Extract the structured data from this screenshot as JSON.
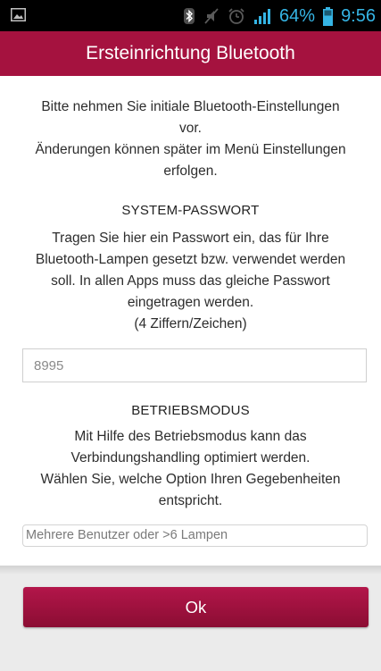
{
  "status_bar": {
    "battery_percent": "64%",
    "time": "9:56",
    "icons": [
      "image-icon",
      "bluetooth-icon",
      "mute-icon",
      "alarm-icon",
      "signal-icon",
      "battery-icon"
    ]
  },
  "header": {
    "title": "Ersteinrichtung Bluetooth"
  },
  "intro": {
    "lines": [
      "Bitte nehmen Sie initiale Bluetooth-Einstellungen",
      "vor.",
      "Änderungen können später im Menü Einstellungen",
      "erfolgen."
    ]
  },
  "password": {
    "heading": "SYSTEM-PASSWORT",
    "lines": [
      "Tragen Sie hier ein Passwort ein, das für Ihre",
      "Bluetooth-Lampen gesetzt bzw. verwendet werden",
      "soll. In allen Apps muss das gleiche Passwort",
      "eingetragen werden.",
      "(4 Ziffern/Zeichen)"
    ],
    "value": "8995"
  },
  "mode": {
    "heading": "BETRIEBSMODUS",
    "lines": [
      "Mit Hilfe des Betriebsmodus kann das",
      "Verbindungshandling optimiert werden.",
      "Wählen Sie, welche Option Ihren Gegebenheiten",
      "entspricht."
    ],
    "selected": "Mehrere Benutzer oder >6 Lampen"
  },
  "ok_button": {
    "label": "Ok"
  },
  "colors": {
    "brand": "#a5123f",
    "status_accent": "#35b5e5",
    "page_background": "#ebebeb"
  }
}
